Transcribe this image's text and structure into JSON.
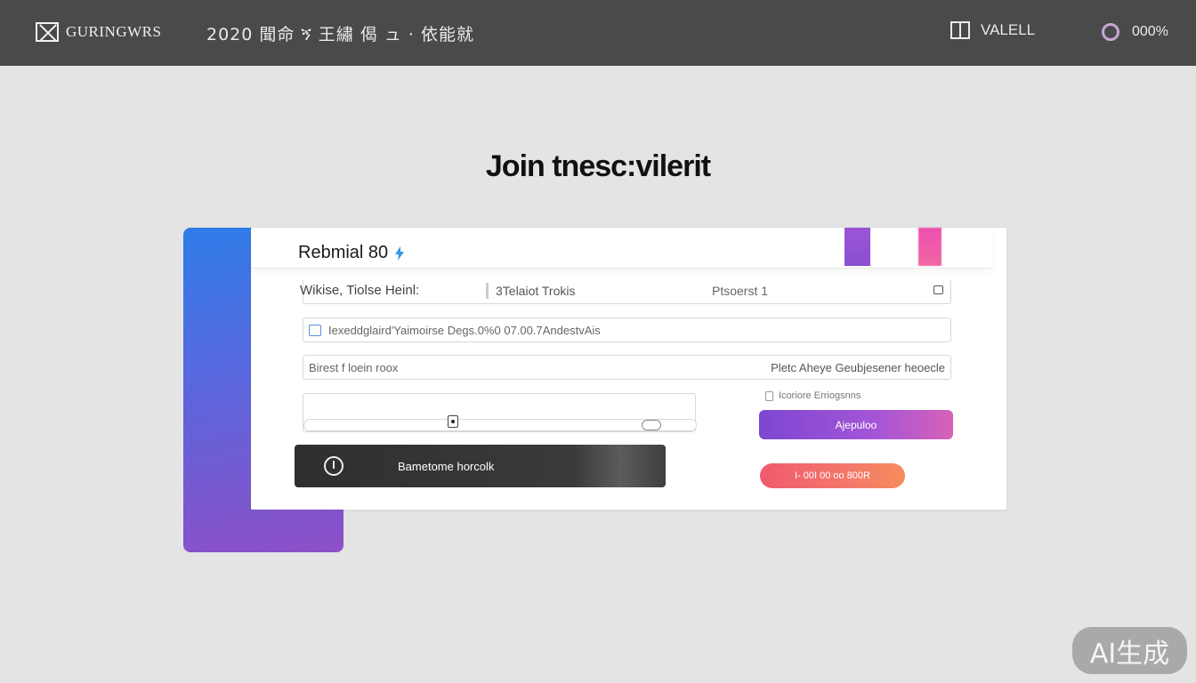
{
  "topbar": {
    "logo_text": "GURINGWRS",
    "info_text": "2020 聞命 ኝ 王繡 偈 ュ · 依能就",
    "account_label": "VALELL",
    "status_value": "000%",
    "status_ring_color": "#c9a7d8"
  },
  "page": {
    "title": "Join tnesc:vilerit"
  },
  "card": {
    "title": "Rebmial 80",
    "field_row": {
      "label_a": "Wikise, Tiolse Heinl:",
      "label_b": "3Telaiot Trokis",
      "label_c": "Ptsoerst 1"
    },
    "field_long": {
      "text": "Iexeddglaird'Yaimoirse Degs.0%0 07.00.7AndestvAis"
    },
    "field_split": {
      "left_text": "Birest f loein roox",
      "right_text": "Pletc Aheye Geubjesener heoecle"
    },
    "remember_label": "Icoriore Erriogsnns",
    "primary_button": "Ajepuloo",
    "dark_button": "Bametome horcolk",
    "pill_button": "I- 00I 00 oo 800R"
  },
  "colors": {
    "accent_purple": "#8a4fd0",
    "accent_pink": "#ee4fb0",
    "accent_blue": "#2f7de9",
    "cta_orange": "#f4776a",
    "topbar": "#4a4a4a"
  },
  "watermark": "AI生成"
}
